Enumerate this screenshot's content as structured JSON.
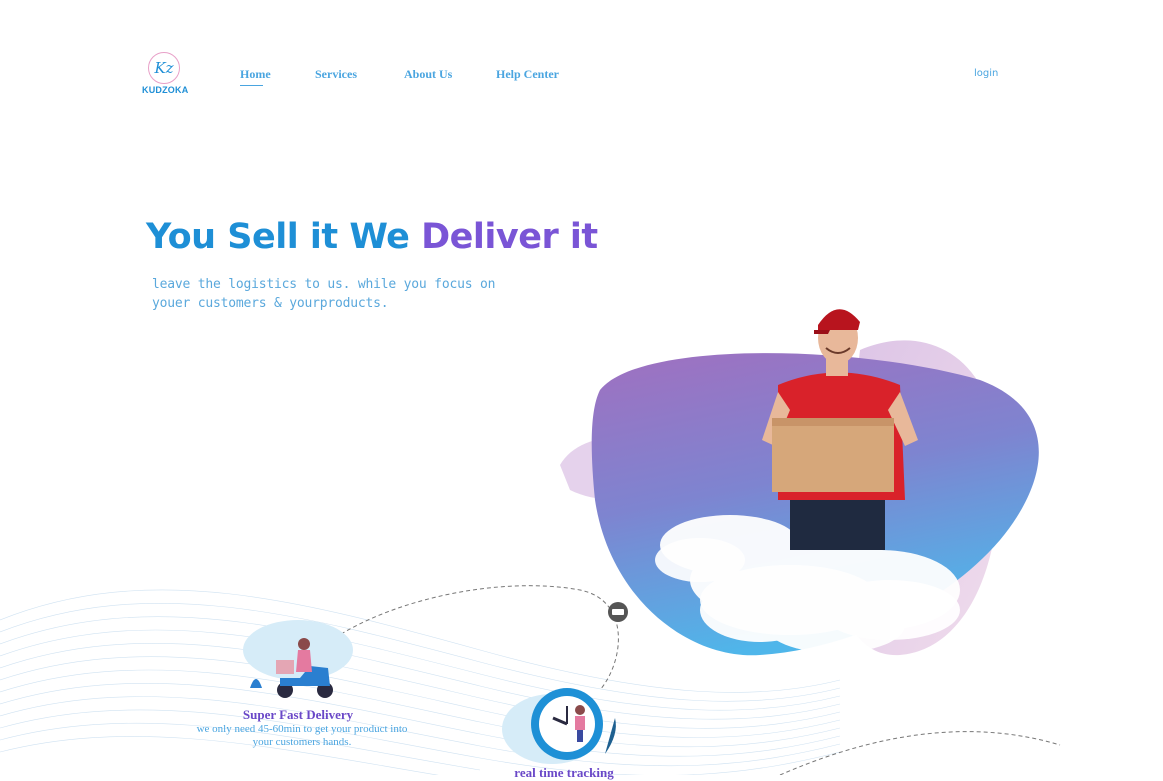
{
  "brand": {
    "logo_mark": "Kz",
    "logo_text": "KUDZOKA",
    "accent": "#1e8fd6",
    "secondary": "#7a55d6"
  },
  "nav": {
    "items": [
      {
        "label": "Home",
        "active": true
      },
      {
        "label": "Services"
      },
      {
        "label": "About Us"
      },
      {
        "label": "Help Center"
      }
    ],
    "login_label": "login"
  },
  "hero": {
    "headline_part1": "You Sell it We ",
    "headline_part2": "Deliver it",
    "subtext": "leave the logistics to us. while you focus on youer customers & yourproducts."
  },
  "features": [
    {
      "title": "Super Fast Delivery",
      "description": "we only need 45-60min to get your product into your customers hands.",
      "icon": "scooter-delivery-icon"
    },
    {
      "title": "real time tracking",
      "icon": "clock-icon"
    }
  ]
}
